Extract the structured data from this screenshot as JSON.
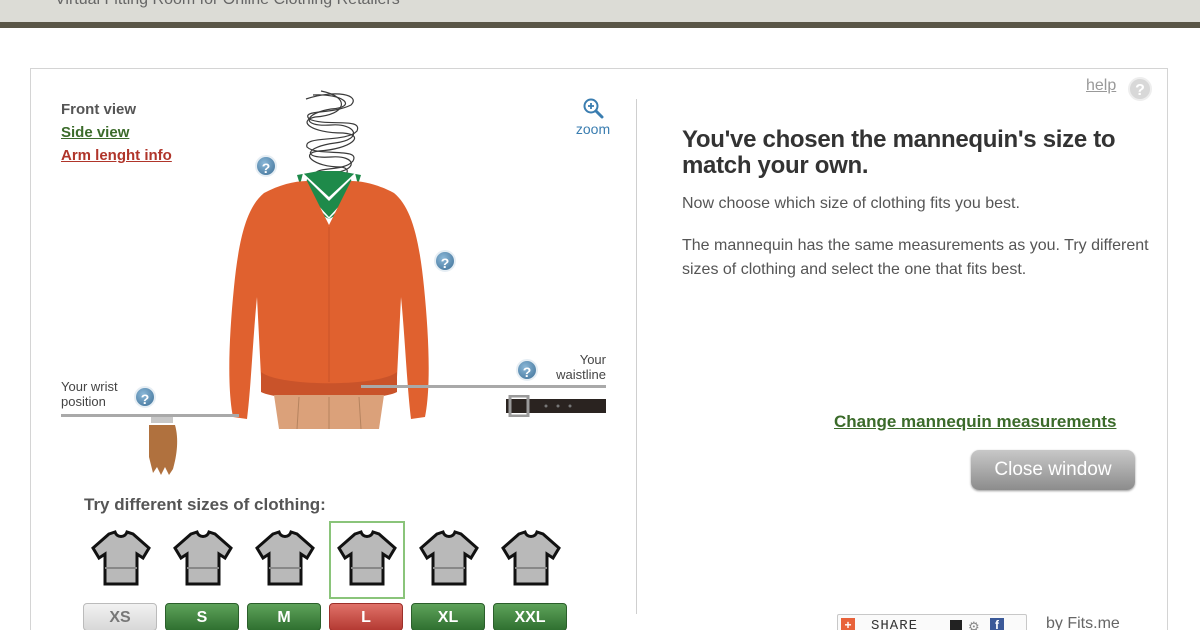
{
  "header": {
    "title": "Virtual Fitting Room for Online Clothing Retailers"
  },
  "views": {
    "front": "Front view",
    "side": "Side view",
    "arm": "Arm lenght info"
  },
  "zoom_label": "zoom",
  "help_icon_glyph": "?",
  "mannequin": {
    "wrist_label": "Your wrist position",
    "waist_label": "Your waistline"
  },
  "sizes": {
    "title": "Try different sizes of clothing:",
    "options": [
      {
        "label": "XS",
        "style": "gray"
      },
      {
        "label": "S",
        "style": "green"
      },
      {
        "label": "M",
        "style": "green"
      },
      {
        "label": "L",
        "style": "red",
        "selected": true
      },
      {
        "label": "XL",
        "style": "green"
      },
      {
        "label": "XXL",
        "style": "green"
      }
    ]
  },
  "help": {
    "label": "help",
    "glyph": "?"
  },
  "info": {
    "headline": "You've chosen the mannequin's size to match your own.",
    "p1": "Now choose which size of clothing fits you best.",
    "p2": "The mannequin has the same measurements as you. Try different sizes of clothing and select the one that fits best."
  },
  "actions": {
    "change_measurements": "Change mannequin measurements",
    "close_window": "Close window"
  },
  "footer": {
    "share_label": "SHARE",
    "by": "by Fits.me"
  },
  "colors": {
    "sweater": "#e0612f",
    "collar": "#1e8a4a",
    "accent_green": "#3b6b2a",
    "accent_red": "#b0352a"
  }
}
